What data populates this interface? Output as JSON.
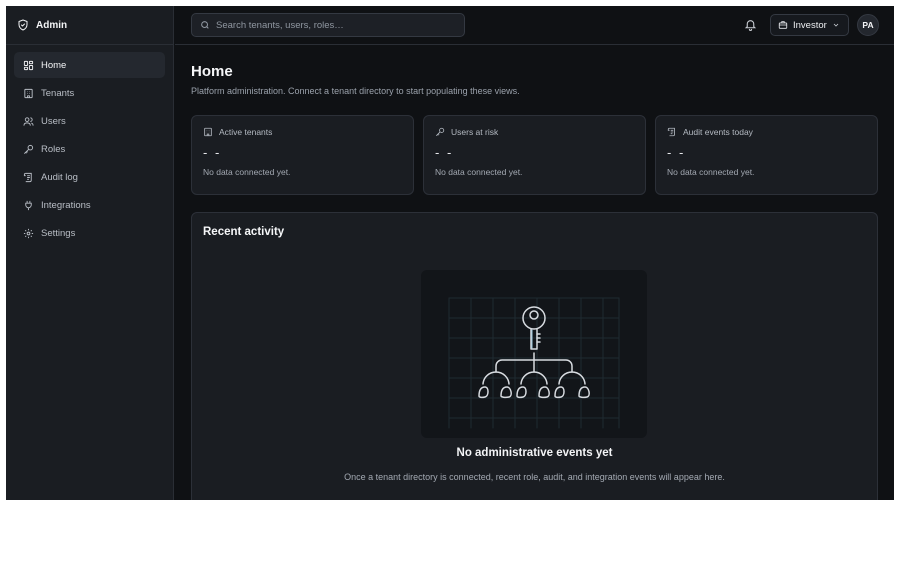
{
  "brand": {
    "label": "Admin",
    "icon": "shield-icon"
  },
  "sidebar": {
    "items": [
      {
        "label": "Home",
        "icon": "grid-icon",
        "active": true
      },
      {
        "label": "Tenants",
        "icon": "building-icon",
        "active": false
      },
      {
        "label": "Users",
        "icon": "users-icon",
        "active": false
      },
      {
        "label": "Roles",
        "icon": "key-icon",
        "active": false
      },
      {
        "label": "Audit log",
        "icon": "scroll-icon",
        "active": false
      },
      {
        "label": "Integrations",
        "icon": "plug-icon",
        "active": false
      },
      {
        "label": "Settings",
        "icon": "gear-icon",
        "active": false
      }
    ]
  },
  "topbar": {
    "search_placeholder": "Search tenants, users, roles…",
    "workspace": "Investor",
    "avatar_initials": "PA"
  },
  "page": {
    "title": "Home",
    "subtitle": "Platform administration. Connect a tenant directory to start populating these views."
  },
  "stats": [
    {
      "label": "Active tenants",
      "value": "- -",
      "note": "No data connected yet.",
      "icon": "building-icon"
    },
    {
      "label": "Users at risk",
      "value": "- -",
      "note": "No data connected yet.",
      "icon": "key-icon"
    },
    {
      "label": "Audit events today",
      "value": "- -",
      "note": "No data connected yet.",
      "icon": "scroll-icon"
    }
  ],
  "activity": {
    "title": "Recent activity",
    "empty_title": "No administrative events yet",
    "empty_text": "Once a tenant directory is connected, recent role, audit, and integration events will appear here."
  },
  "colors": {
    "background": "#0f1114",
    "panel": "#1a1d22",
    "border": "#2c3038",
    "text": "#e6e8eb",
    "muted": "#9aa1ab",
    "accent_key": "#9bc7dc"
  }
}
